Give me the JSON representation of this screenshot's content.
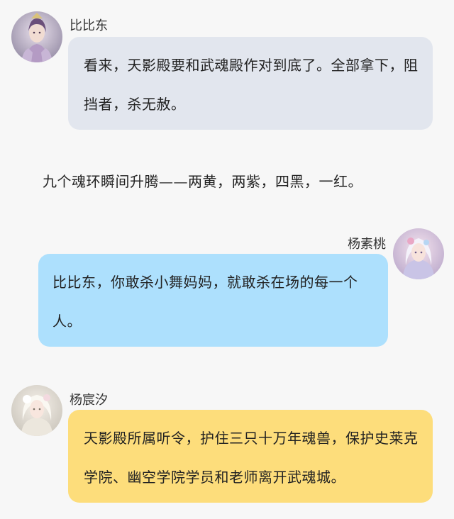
{
  "messages": [
    {
      "speaker": "比比东",
      "text": "看来，天影殿要和武魂殿作对到底了。全部拿下，阻挡者，杀无赦。",
      "bubble_color": "#e2e6ee",
      "avatar_icon": "purple-armored-woman-avatar"
    },
    {
      "narration": "九个魂环瞬间升腾——两黄，两紫，四黑，一红。"
    },
    {
      "speaker": "杨素桃",
      "text": "比比东，你敢杀小舞妈妈，就敢杀在场的每一个人。",
      "bubble_color": "#ade0fd",
      "avatar_icon": "white-haired-woman-avatar"
    },
    {
      "speaker": "杨宸汐",
      "text": "天影殿所属听令，护住三只十万年魂兽，保护史莱克学院、幽空学院学员和老师离开武魂城。",
      "bubble_color": "#fddd7b",
      "avatar_icon": "white-flowered-woman-avatar"
    }
  ]
}
